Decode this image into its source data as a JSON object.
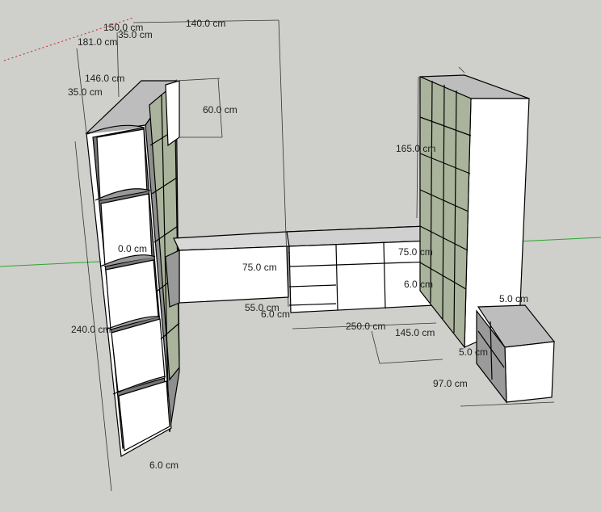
{
  "viewport": {
    "background": "#cfcfcc",
    "face_white": "#ffffff",
    "face_shade": "#bdbdbd",
    "face_dark": "#8a8a8a",
    "shelf_glass": "#aab39b",
    "axis_green": "#2ea32e",
    "axis_red": "#cc2222"
  },
  "dimensions": {
    "d1": "150.0 cm",
    "d2": "181.0 cm",
    "d3": "35.0 cm",
    "d4": "140.0 cm",
    "d5": "146.0 cm",
    "d6": "35.0 cm",
    "d7": "60.0 cm",
    "d8": "165.0 cm",
    "d9": "75.0 cm",
    "d10": "75.0 cm",
    "d11": "6.0 cm",
    "d12": "55.0 cm",
    "d13": "6.0 cm",
    "d14": "240.0 cm",
    "d15": "250.0 cm",
    "d16": "145.0 cm",
    "d17": "5.0 cm",
    "d18": "5.0 cm",
    "d19": "97.0 cm",
    "d20": "6.0 cm",
    "d21": "0.0 cm"
  }
}
